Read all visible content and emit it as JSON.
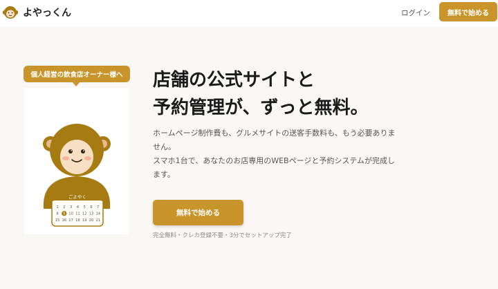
{
  "header": {
    "brand": "よやっくん",
    "login_label": "ログイン",
    "cta_label": "無料で始める"
  },
  "hero": {
    "badge": "個人経営の飲食店オーナー様へ",
    "headline_line1": "店舗の公式サイトと",
    "headline_line2": "予約管理が、ずっと無料。",
    "description_line1": "ホームページ制作費も、グルメサイトの送客手数料も、もう必要ありま",
    "description_line2": "せん。",
    "description_line3": "スマホ1台で、あなたのお店専用のWEBページと予約システムが完成し",
    "description_line4": "ます。",
    "cta_label": "無料で始める",
    "cta_note": "完全無料・クレカ登録不要・3分でセットアップ完了"
  },
  "illustration": {
    "calendar_title": "ごよやく",
    "calendar_rows": [
      [
        "1",
        "2",
        "3",
        "4",
        "5",
        "6",
        "7"
      ],
      [
        "8",
        "9",
        "10",
        "11",
        "12",
        "13",
        "14"
      ],
      [
        "15",
        "16",
        "17",
        "18",
        "19",
        "20",
        "21"
      ]
    ],
    "highlighted_day": "9"
  },
  "colors": {
    "accent": "#c9952a",
    "monkey_brown": "#a67b12",
    "face": "#f7dfc4",
    "background": "#faf8f5"
  }
}
